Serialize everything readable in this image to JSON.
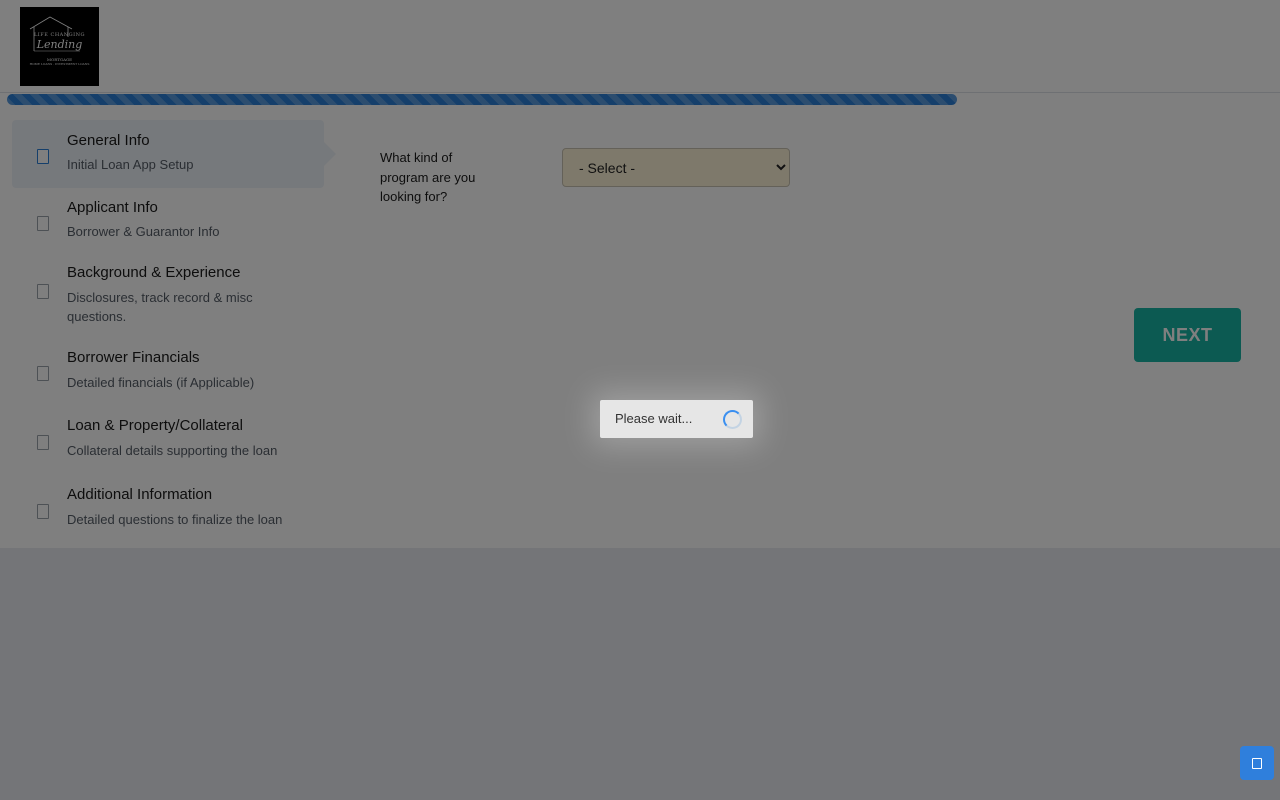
{
  "logo": {
    "line1": "LIFE CHANGING",
    "script": "Lending",
    "line2": "MORTGAGE",
    "line3": "HOME LOANS · INVESTMENT LOANS"
  },
  "progress": {
    "percent": 75
  },
  "steps": [
    {
      "title": "General Info",
      "subtitle": "Initial Loan App Setup"
    },
    {
      "title": "Applicant Info",
      "subtitle": "Borrower & Guarantor Info"
    },
    {
      "title": "Background & Experience",
      "subtitle": "Disclosures, track record & misc questions."
    },
    {
      "title": "Borrower Financials",
      "subtitle": "Detailed financials (if Applicable)"
    },
    {
      "title": "Loan & Property/Collateral",
      "subtitle": "Collateral details supporting the loan"
    },
    {
      "title": "Additional Information",
      "subtitle": "Detailed questions to finalize the loan"
    }
  ],
  "form": {
    "question": "What kind of program are you looking for?",
    "select_value": "- Select -"
  },
  "next_label": "NEXT",
  "loading": {
    "text": "Please wait..."
  },
  "colors": {
    "progress": "#2a7fd6",
    "next_button": "#19b5a4",
    "select_bg": "#fdf3d6",
    "chat_button": "#2f7fdc"
  },
  "icons": {
    "chat": "chat-icon",
    "spinner": "spinner-icon"
  }
}
